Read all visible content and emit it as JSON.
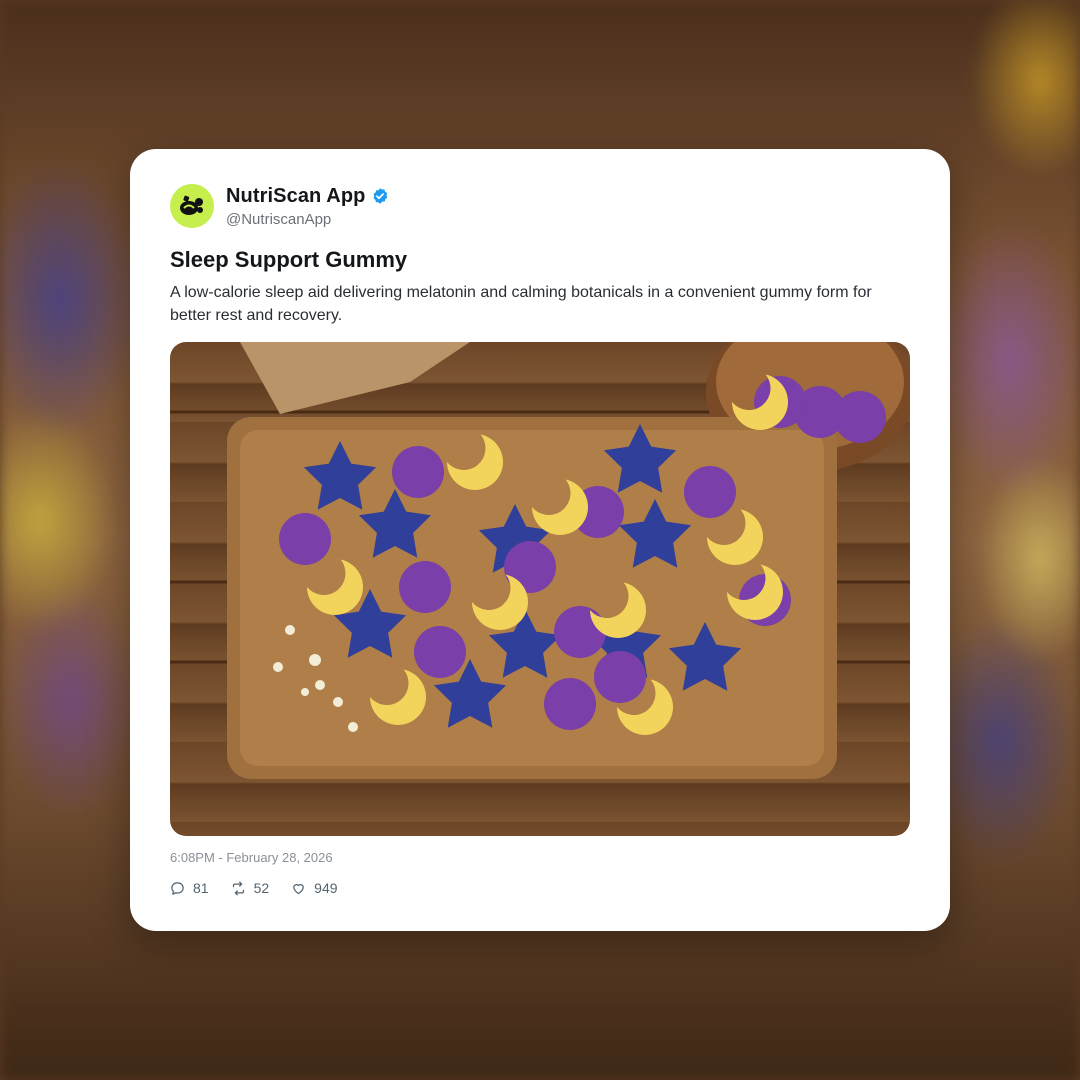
{
  "post": {
    "author": {
      "display_name": "NutriScan App",
      "handle": "@NutriscanApp",
      "verified": true,
      "avatar_color": "#c6ee4c"
    },
    "title": "Sleep Support Gummy",
    "description": "A low-calorie sleep aid delivering melatonin and calming botanicals in a convenient gummy form for better rest and recovery.",
    "timestamp": "6:08PM - February 28, 2026",
    "stats": {
      "replies": "81",
      "reposts": "52",
      "likes": "949"
    },
    "icons": {
      "reply": "comment-icon",
      "repost": "repost-icon",
      "like": "heart-icon",
      "verified": "verified-badge-icon"
    }
  },
  "colors": {
    "verified_blue": "#1d9bf0",
    "gummy_blue": "#2f3f9a",
    "gummy_purple": "#7a3fa8",
    "gummy_yellow": "#f2d45c"
  }
}
